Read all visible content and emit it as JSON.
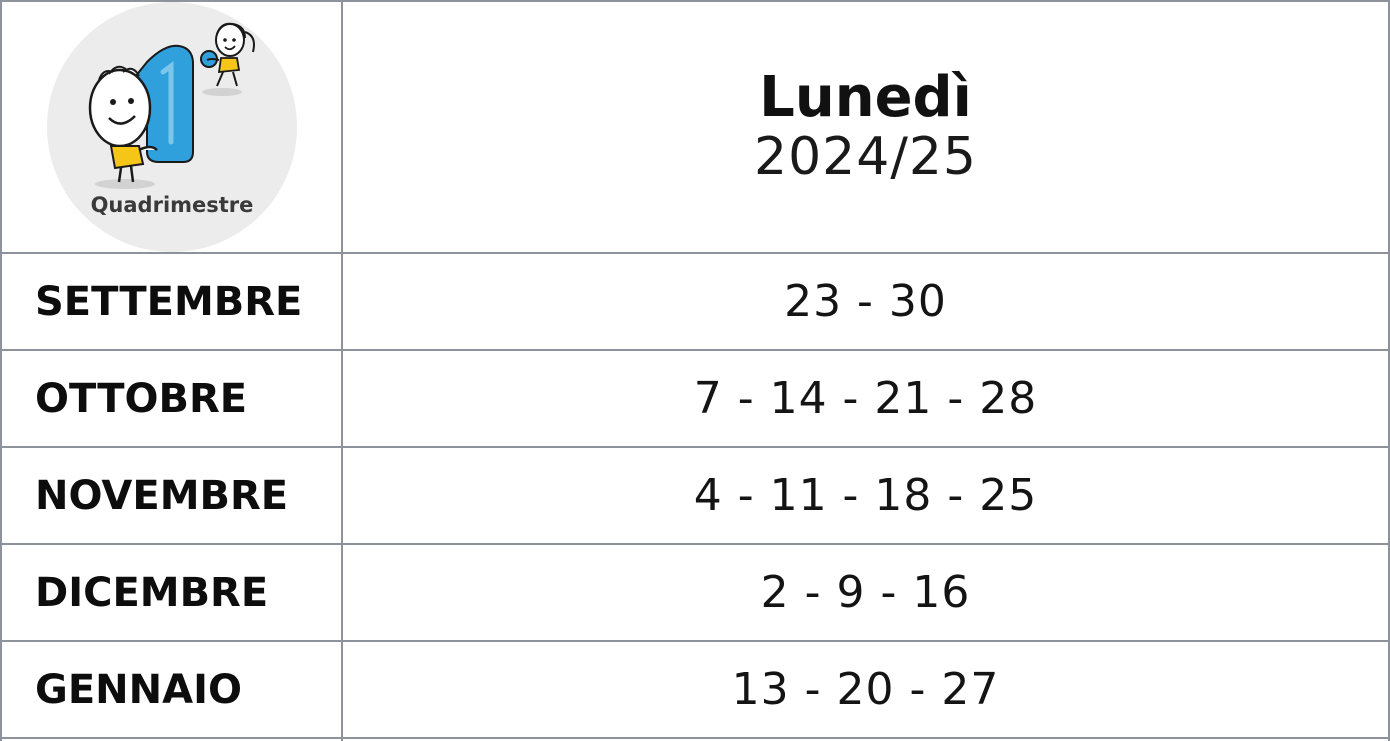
{
  "header": {
    "day": "Lunedì",
    "school_year": "2024/25",
    "logo": {
      "badge_text": "1°",
      "caption": "Quadrimestre",
      "badge_color": "#2fa0dc",
      "circle_color": "#ececec",
      "accent_color": "#f5c518"
    }
  },
  "rows": [
    {
      "month": "SETTEMBRE",
      "days": "23 - 30"
    },
    {
      "month": "OTTOBRE",
      "days": "7 - 14 - 21 - 28"
    },
    {
      "month": "NOVEMBRE",
      "days": "4 - 11 - 18 - 25"
    },
    {
      "month": "DICEMBRE",
      "days": "2 - 9 - 16"
    },
    {
      "month": "GENNAIO",
      "days": "13 - 20 - 27"
    }
  ],
  "colors": {
    "grid_line": "#8e939b",
    "text": "#111111"
  }
}
